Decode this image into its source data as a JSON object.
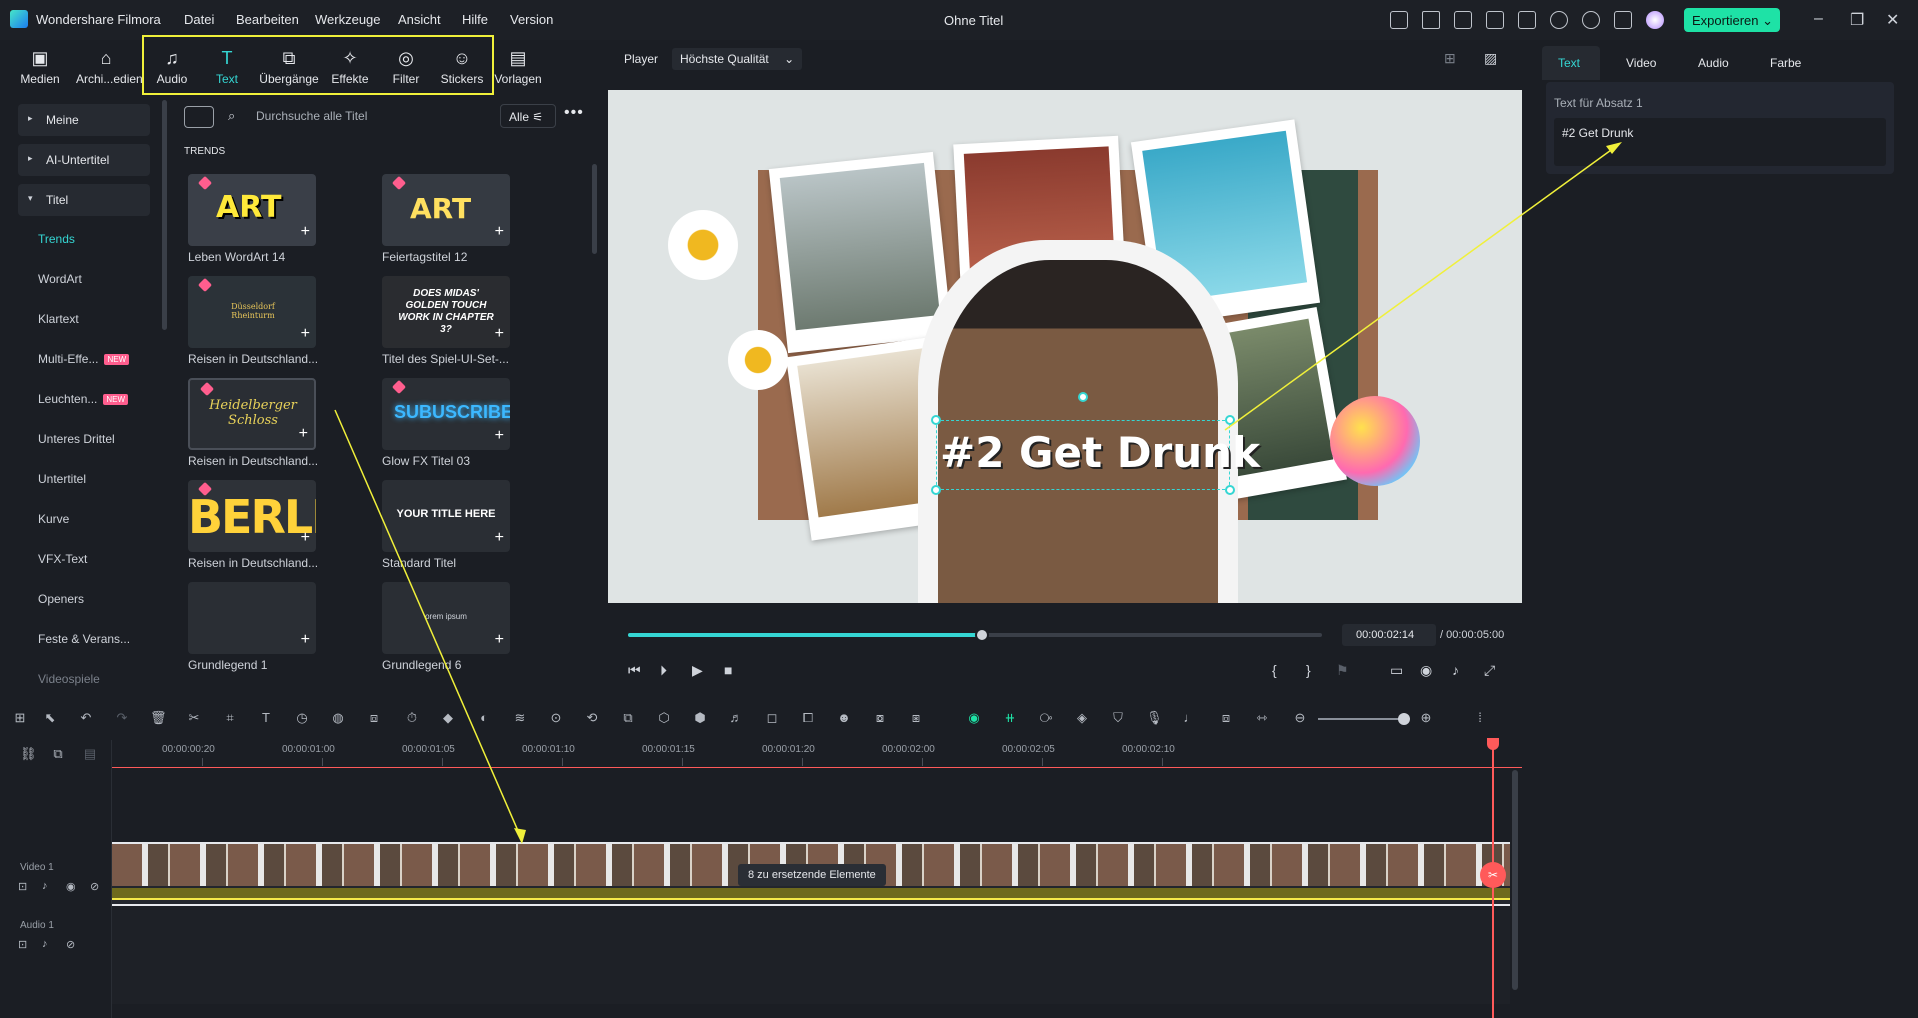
{
  "app": {
    "name": "Wondershare Filmora",
    "document_title": "Ohne Titel",
    "export_label": "Exportieren"
  },
  "menu": [
    "Datei",
    "Bearbeiten",
    "Werkzeuge",
    "Ansicht",
    "Hilfe",
    "Version"
  ],
  "media_tabs": [
    {
      "label": "Medien",
      "icon": "media-icon"
    },
    {
      "label": "Archi...edien",
      "icon": "archive-icon"
    },
    {
      "label": "Audio",
      "icon": "music-note-icon"
    },
    {
      "label": "Text",
      "icon": "text-icon",
      "active": true
    },
    {
      "label": "Übergänge",
      "icon": "transition-icon"
    },
    {
      "label": "Effekte",
      "icon": "effects-icon"
    },
    {
      "label": "Filter",
      "icon": "filter-icon"
    },
    {
      "label": "Stickers",
      "icon": "sticker-icon"
    },
    {
      "label": "Vorlagen",
      "icon": "templates-icon"
    }
  ],
  "left_nav": {
    "groups": [
      "Meine",
      "AI-Untertitel",
      "Titel"
    ],
    "items": [
      {
        "label": "Trends",
        "active": true
      },
      {
        "label": "WordArt"
      },
      {
        "label": "Klartext"
      },
      {
        "label": "Multi-Effe...",
        "badge": "NEW"
      },
      {
        "label": "Leuchten...",
        "badge": "NEW"
      },
      {
        "label": "Unteres Drittel"
      },
      {
        "label": "Untertitel"
      },
      {
        "label": "Kurve"
      },
      {
        "label": "VFX-Text"
      },
      {
        "label": "Openers"
      },
      {
        "label": "Feste & Verans..."
      },
      {
        "label": "Videospiele"
      }
    ]
  },
  "library": {
    "search_placeholder": "Durchsuche alle Titel",
    "filter_label": "Alle",
    "section": "TRENDS",
    "cards": [
      {
        "label": "Leben WordArt 14",
        "thumb_text": "ART"
      },
      {
        "label": "Feiertagstitel 12",
        "thumb_text": "ART"
      },
      {
        "label": "Reisen in Deutschland...",
        "thumb_text": "Düsseldorf Rheinturm"
      },
      {
        "label": "Titel des Spiel-UI-Set-...",
        "thumb_text": "DOES MIDAS' GOLDEN TOUCH WORK IN CHAPTER 3?"
      },
      {
        "label": "Reisen in Deutschland...",
        "thumb_text": "Heidelberger Schloss"
      },
      {
        "label": "Glow FX Titel 03",
        "thumb_text": "SUBUSCRIBE"
      },
      {
        "label": "Reisen in Deutschland...",
        "thumb_text": "BERLIN"
      },
      {
        "label": "Standard Titel",
        "thumb_text": "YOUR TITLE HERE"
      },
      {
        "label": "Grundlegend 1",
        "thumb_text": ""
      },
      {
        "label": "Grundlegend 6",
        "thumb_text": "orem ipsum"
      }
    ]
  },
  "player": {
    "label": "Player",
    "quality": "Höchste Qualität",
    "overlay_title": "#2 Get Drunk",
    "current_time": "00:00:02:14",
    "total_time": "/ 00:00:05:00",
    "progress": 0.51
  },
  "properties": {
    "tabs": [
      "Text",
      "Video",
      "Audio",
      "Farbe"
    ],
    "active_tab": "Text",
    "section_label": "Text für Absatz 1",
    "text_value": "#2  Get Drunk"
  },
  "timeline": {
    "ruler_labels": [
      "00:00:00:20",
      "00:00:01:00",
      "00:00:01:05",
      "00:00:01:10",
      "00:00:01:15",
      "00:00:01:20",
      "00:00:02:00",
      "00:00:02:05",
      "00:00:02:10"
    ],
    "video_track_label": "Video 1",
    "audio_track_label": "Audio 1",
    "clip_tooltip": "8 zu ersetzende Elemente"
  },
  "colors": {
    "accent": "#35d6d3",
    "export": "#1ee2a6",
    "playhead": "#ff5a5a",
    "annotation": "#f0f03a"
  }
}
